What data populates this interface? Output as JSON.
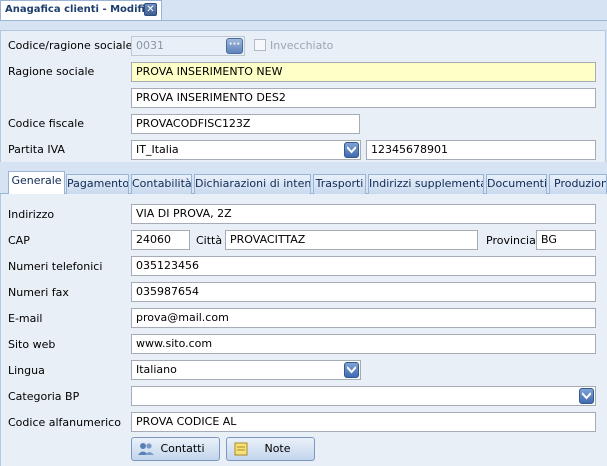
{
  "window": {
    "tab_title": "Anagafica clienti - Modifica"
  },
  "header": {
    "codice_label": "Codice/ragione sociale",
    "codice_value": "0031",
    "invecchiato_label": "Invecchiato",
    "ragione_label": "Ragione sociale",
    "ragione_value1": "PROVA INSERIMENTO NEW",
    "ragione_value2": "PROVA INSERIMENTO DES2",
    "cf_label": "Codice fiscale",
    "cf_value": "PROVACODFISC123Z",
    "piva_label": "Partita IVA",
    "piva_country": "IT_Italia",
    "piva_value": "12345678901"
  },
  "tabs": [
    {
      "label": "Generale"
    },
    {
      "label": "Pagamento"
    },
    {
      "label": "Contabilità"
    },
    {
      "label": "Dichiarazioni di intento"
    },
    {
      "label": "Trasporti"
    },
    {
      "label": "Indirizzi supplementari"
    },
    {
      "label": "Documenti"
    },
    {
      "label": "Produzione"
    }
  ],
  "general": {
    "indirizzo_label": "Indirizzo",
    "indirizzo_value": "VIA DI PROVA, 2Z",
    "cap_label": "CAP",
    "cap_value": "24060",
    "citta_label": "Città",
    "citta_value": "PROVACITTAZ",
    "provincia_label": "Provincia",
    "provincia_value": "BG",
    "tel_label": "Numeri telefonici",
    "tel_value": "035123456",
    "fax_label": "Numeri fax",
    "fax_value": "035987654",
    "email_label": "E-mail",
    "email_value": "prova@mail.com",
    "web_label": "Sito web",
    "web_value": "www.sito.com",
    "lingua_label": "Lingua",
    "lingua_value": "Italiano",
    "categoria_label": "Categoria BP",
    "categoria_value": "",
    "alfanum_label": "Codice alfanumerico",
    "alfanum_value": "PROVA CODICE AL"
  },
  "buttons": {
    "contatti": "Contatti",
    "note": "Note"
  },
  "colors": {
    "accent": "#3f6bb0",
    "highlight_field": "#ffffc8",
    "panel": "#e9eff7"
  }
}
